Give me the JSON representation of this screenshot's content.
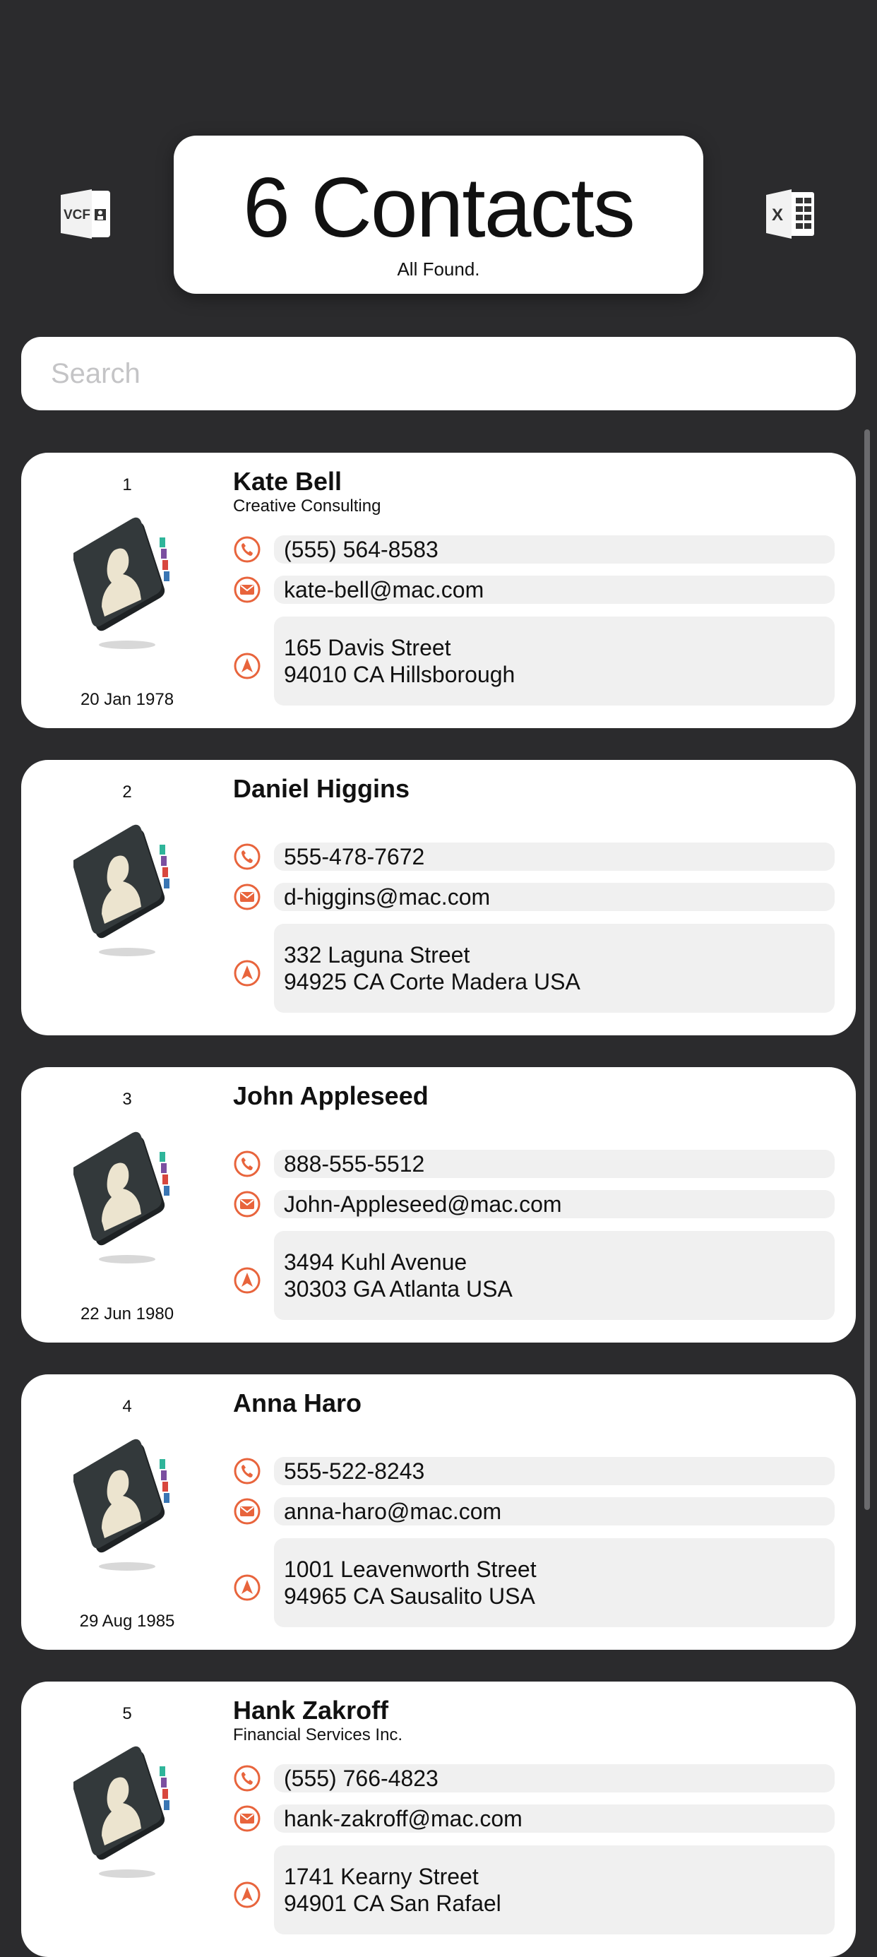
{
  "header": {
    "title": "6 Contacts",
    "subtitle": "All Found."
  },
  "export": {
    "vcf_label": "VCF",
    "excel_label": "X"
  },
  "search": {
    "placeholder": "Search",
    "value": ""
  },
  "icons": {
    "phone": "phone-icon",
    "email": "email-icon",
    "address": "location-arrow-icon",
    "accent": "#e8643c"
  },
  "contacts": [
    {
      "index": "1",
      "name": "Kate Bell",
      "company": "Creative Consulting",
      "phone": "(555) 564-8583",
      "email": "kate-bell@mac.com",
      "address_line1": "165 Davis Street",
      "address_line2": "94010 CA Hillsborough",
      "birthday": "20 Jan 1978"
    },
    {
      "index": "2",
      "name": "Daniel Higgins",
      "company": "",
      "phone": "555-478-7672",
      "email": "d-higgins@mac.com",
      "address_line1": "332 Laguna Street",
      "address_line2": "94925 CA Corte Madera USA",
      "birthday": ""
    },
    {
      "index": "3",
      "name": "John Appleseed",
      "company": "",
      "phone": "888-555-5512",
      "email": "John-Appleseed@mac.com",
      "address_line1": "3494 Kuhl Avenue",
      "address_line2": "30303 GA Atlanta USA",
      "birthday": "22 Jun 1980"
    },
    {
      "index": "4",
      "name": "Anna Haro",
      "company": "",
      "phone": "555-522-8243",
      "email": "anna-haro@mac.com",
      "address_line1": "1001  Leavenworth Street",
      "address_line2": "94965 CA Sausalito USA",
      "birthday": "29 Aug 1985"
    },
    {
      "index": "5",
      "name": "Hank Zakroff",
      "company": "Financial Services Inc.",
      "phone": "(555) 766-4823",
      "email": "hank-zakroff@mac.com",
      "address_line1": "1741 Kearny Street",
      "address_line2": "94901 CA San Rafael",
      "birthday": ""
    }
  ]
}
